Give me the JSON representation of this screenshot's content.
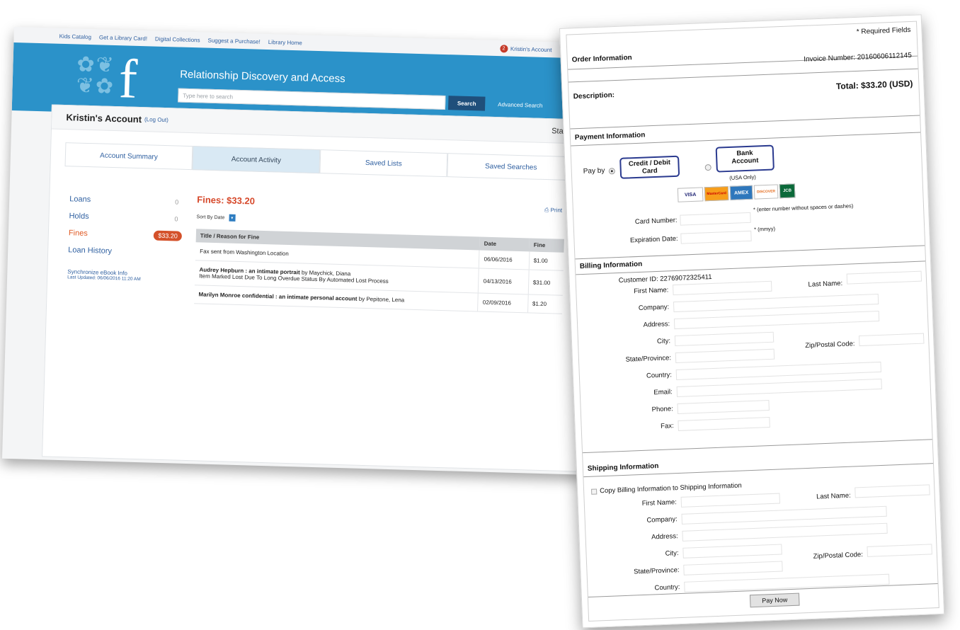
{
  "library": {
    "toplinks": [
      "Kids Catalog",
      "Get a Library Card!",
      "Digital Collections",
      "Suggest a Purchase!",
      "Library Home"
    ],
    "account_link": "Kristin's Account",
    "notification_count": "2",
    "banner_title": "Relationship Discovery and Access",
    "logo_letter": "f",
    "search_placeholder": "Type here to search",
    "search_button": "Search",
    "advanced_search": "Advanced Search",
    "account_name": "Kristin's Account",
    "logout": "(Log Out)",
    "status": "Status: A",
    "tabs": [
      "Account Summary",
      "Account Activity",
      "Saved Lists",
      "Saved Searches"
    ],
    "sidebar": {
      "loans": "Loans",
      "loans_count": "0",
      "holds": "Holds",
      "holds_count": "0",
      "fines": "Fines",
      "fines_amount": "$33.20",
      "loan_history": "Loan History",
      "sync": "Synchronize eBook Info",
      "last_updated": "Last Updated: 06/06/2016 11:20 AM"
    },
    "fines_title": "Fines: $33.20",
    "print": "Print",
    "sort": "Sort By Date",
    "table_headers": [
      "Title / Reason for Fine",
      "Date",
      "Fine"
    ],
    "rows": [
      {
        "title": "Fax sent from Washington Location",
        "by": "",
        "note": "",
        "date": "06/06/2016",
        "fine": "$1.00"
      },
      {
        "title": "Audrey Hepburn : an intimate portrait",
        "by": "by Maychick, Diana",
        "note": "Item Marked Lost Due To Long Overdue Status By Automated Lost Process",
        "date": "04/13/2016",
        "fine": "$31.00"
      },
      {
        "title": "Marilyn Monroe confidential : an intimate personal account",
        "by": "by Pepitone, Lena",
        "note": "",
        "date": "02/09/2016",
        "fine": "$1.20"
      }
    ]
  },
  "payment": {
    "required": "* Required Fields",
    "order_info": "Order Information",
    "invoice": "Invoice Number: 20160606112145",
    "description": "Description:",
    "total_label": "Total:",
    "total_value": "$33.20 (USD)",
    "payment_info": "Payment Information",
    "pay_by": "Pay by",
    "credit_line1": "Credit / Debit",
    "credit_line2": "Card",
    "bank_line1": "Bank",
    "bank_line2": "Account",
    "usa_only": "(USA Only)",
    "card_brands": [
      "VISA",
      "MasterCard",
      "AMEX",
      "DISCOVER",
      "JCB"
    ],
    "card_number": "Card Number:",
    "card_hint": "* (enter number without spaces or dashes)",
    "expiration": "Expiration Date:",
    "exp_hint": "* (mmyy)",
    "billing_info": "Billing Information",
    "customer_id": "Customer ID: 22769072325411",
    "first_name": "First Name:",
    "last_name": "Last Name:",
    "company": "Company:",
    "address": "Address:",
    "city": "City:",
    "zip": "Zip/Postal Code:",
    "state": "State/Province:",
    "country": "Country:",
    "email": "Email:",
    "phone": "Phone:",
    "fax": "Fax:",
    "shipping_info": "Shipping Information",
    "copy_billing": "Copy Billing Information to Shipping Information",
    "pay_now": "Pay Now"
  },
  "colors": {
    "banner_blue": "#2b92c9",
    "fines_red": "#d6482a",
    "link_blue": "#2e5fa0",
    "button_border": "#2a3a8f"
  }
}
